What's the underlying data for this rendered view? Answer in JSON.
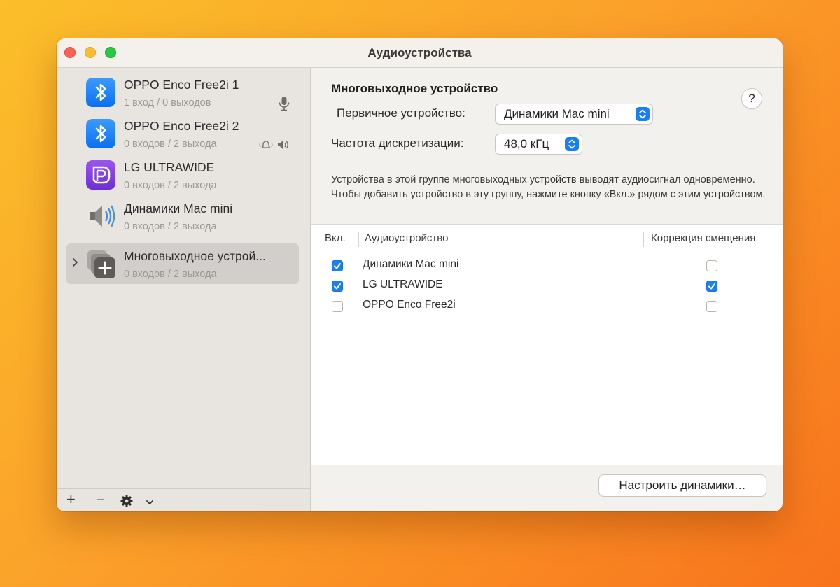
{
  "window": {
    "title": "Аудиоустройства"
  },
  "sidebar": {
    "devices": [
      {
        "name": "OPPO Enco Free2i 1",
        "io": "1 вход / 0 выходов",
        "icon": "bluetooth-icon",
        "badge": "microphone-icon"
      },
      {
        "name": "OPPO Enco Free2i 2",
        "io": "0 входов / 2 выхода",
        "icon": "bluetooth-icon",
        "badge": "speaker-alert-icons"
      },
      {
        "name": "LG ULTRAWIDE",
        "io": "0 входов / 2 выхода",
        "icon": "displayport-icon"
      },
      {
        "name": "Динамики Mac mini",
        "io": "0 входов / 2 выхода",
        "icon": "speaker-icon"
      },
      {
        "name": "Многовыходное устрой...",
        "io": "0 входов / 2 выхода",
        "icon": "multi-output-icon",
        "selected": true
      }
    ],
    "footer": {
      "add": "+",
      "remove": "−"
    }
  },
  "main": {
    "title": "Многовыходное устройство",
    "help": "?",
    "primary_label": "Первичное устройство:",
    "primary_value": "Динамики Mac mini",
    "rate_label": "Частота дискретизации:",
    "rate_value": "48,0 кГц",
    "description": "Устройства в этой группе многовыходных устройств выводят аудиосигнал одновременно. Чтобы добавить устройство в эту группу, нажмите кнопку «Вкл.» рядом с этим устройством.",
    "table": {
      "col_on": "Вкл.",
      "col_device": "Аудиоустройство",
      "col_drift": "Коррекция смещения",
      "rows": [
        {
          "on": true,
          "name": "Динамики Mac mini",
          "drift": false
        },
        {
          "on": true,
          "name": "LG ULTRAWIDE",
          "drift": true
        },
        {
          "on": false,
          "name": "OPPO Enco Free2i",
          "drift": false
        }
      ]
    },
    "configure_button": "Настроить динамики…"
  },
  "colors": {
    "accent": "#1a7ef5",
    "bluetooth": "#0a6ff0",
    "displayport": "#7b3fe0"
  }
}
